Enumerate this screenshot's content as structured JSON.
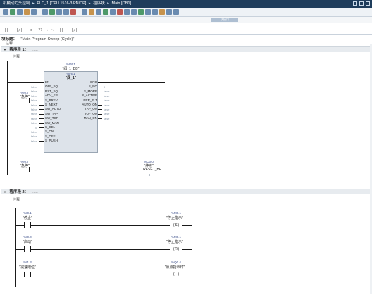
{
  "breadcrumb": {
    "project": "机械动力头控制",
    "device": "PLC_1 [CPU 1516-3 PN/DP]",
    "folder": "程序块",
    "block": "Main [OB1]",
    "separator": "▸"
  },
  "toolbar2": {
    "right_label": "块接口"
  },
  "lad_toolbar": [
    "-||-",
    "-|/|-",
    "-o-",
    "??",
    "↦",
    "↪",
    "-||-",
    "-|/|-"
  ],
  "block_header": {
    "title": "块标题：",
    "subtitle": "\"Main Program Sweep (Cycle)\"",
    "comment": "注释"
  },
  "network1": {
    "title": "程序段 1：",
    "dots": "......",
    "comment": "注释",
    "fb": {
      "db_address": "%DB1",
      "db_name": "\"阀_1_DB\"",
      "fb_address": "%FB1",
      "fb_name": "\"阀_1\"",
      "inputs": [
        "EN",
        "OFF_SQ",
        "RST_SQ",
        "ADV_EP",
        "S_PREV",
        "S_NEXT",
        "SW_AUTO",
        "SW_TAP",
        "SW_TOF",
        "SW_MAN",
        "S_SEL",
        "S_ON",
        "S_OFF",
        "S_PUSH"
      ],
      "outputs": [
        "ENO",
        "S_NO",
        "S_MORE",
        "S_ACTIVE",
        "ERR_FLT",
        "AUTO_ON",
        "TAP_ON",
        "TOF_ON",
        "MAN_ON"
      ],
      "input_values": [
        "",
        "false",
        "false",
        "false",
        "false",
        "false",
        "false",
        "false",
        "false",
        "false",
        "0",
        "false",
        "false",
        "false"
      ],
      "output_values": [
        "",
        "0",
        "false",
        "false",
        "false",
        "false",
        "false",
        "false",
        "false"
      ]
    },
    "contact1": {
      "address": "%I0.7",
      "name": "\"急停\""
    },
    "contact2": {
      "address": "%I0.7",
      "name": "\"急停\""
    },
    "coil": {
      "address": "%Q0.0",
      "name": "\"停液\"",
      "instruction": "RESET_BF",
      "value": "8"
    }
  },
  "network2": {
    "title": "程序段 2：",
    "dots": "......",
    "comment": "注释",
    "rows": [
      {
        "contact_addr": "%I0.1",
        "contact_name": "\"停止\"",
        "coil_addr": "%M0.1",
        "coil_name": "\"停止指示\"",
        "coil_type": "S"
      },
      {
        "contact_addr": "%I0.0",
        "contact_name": "\"启动\"",
        "coil_addr": "%M0.1",
        "coil_name": "\"停止指示\"",
        "coil_type": "R"
      },
      {
        "contact_addr": "%I1.3",
        "contact_name": "\"减速限位\"",
        "coil_addr": "%Q0.4",
        "coil_name": "\"原点指示灯\"",
        "coil_type": ""
      }
    ]
  },
  "colors": {
    "titlebar": "#1f3d5c",
    "fb_fill": "#dde3ea",
    "address": "#3c4f8a"
  }
}
